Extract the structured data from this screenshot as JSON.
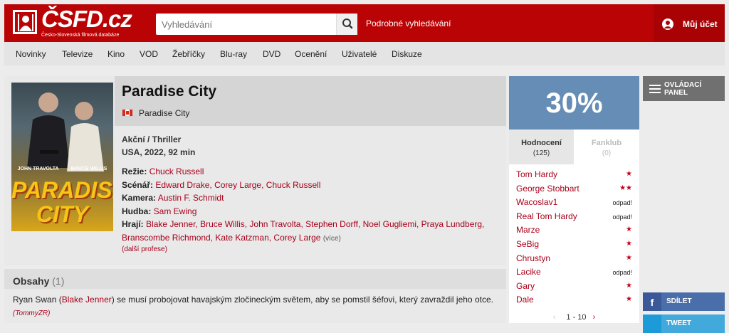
{
  "header": {
    "logo_text": "ČSFD.cz",
    "logo_subtitle": "Česko-Slovenská filmová databáze",
    "search_placeholder": "Vyhledávání",
    "advanced_search": "Podrobné vyhledávání",
    "account_label": "Můj účet",
    "brand_color": "#ba0305"
  },
  "nav": {
    "items": [
      "Novinky",
      "Televize",
      "Kino",
      "VOD",
      "Žebříčky",
      "Blu-ray",
      "DVD",
      "Ocenění",
      "Uživatelé",
      "Diskuze"
    ]
  },
  "film": {
    "title": "Paradise City",
    "original_title": "Paradise City",
    "poster_actor_1": "JOHN TRAVOLTA",
    "poster_actor_2": "BRUCE WILLIS",
    "poster_title": "PARADISE CITY",
    "genre": "Akční / Thriller",
    "origin": "USA, 2022, 92 min",
    "director_label": "Režie:",
    "director": "Chuck Russell",
    "writer_label": "Scénář:",
    "writers": "Edward Drake, Corey Large, Chuck Russell",
    "camera_label": "Kamera:",
    "camera": "Austin F. Schmidt",
    "music_label": "Hudba:",
    "music": "Sam Ewing",
    "cast_label": "Hrají:",
    "cast": "Blake Jenner, Bruce Willis, John Travolta, Stephen Dorff, Noel Gugliemi, Praya Lundberg, Branscombe Richmond, Kate Katzman, Corey Large",
    "cast_more": "(více)",
    "more_professions": "(další profese)"
  },
  "plot": {
    "title": "Obsahy",
    "count": "(1)",
    "text_before": "Ryan Swan (",
    "actor": "Blake Jenner",
    "text_after": ") se musí probojovat havajským zločineckým světem, aby se pomstil šéfovi, který zavraždil jeho otce.",
    "author": "(TommyZR)"
  },
  "rating": {
    "value": "30%",
    "tab_ratings": "Hodnocení",
    "tab_ratings_count": "(125)",
    "tab_fanclub": "Fanklub",
    "tab_fanclub_count": "(0)",
    "users": [
      {
        "name": "Tom Hardy",
        "rating": "★"
      },
      {
        "name": "George Stobbart",
        "rating": "★★"
      },
      {
        "name": "Wacoslav1",
        "rating": "odpad!"
      },
      {
        "name": "Real Tom Hardy",
        "rating": "odpad!"
      },
      {
        "name": "Marze",
        "rating": "★"
      },
      {
        "name": "SeBig",
        "rating": "★"
      },
      {
        "name": "Chrustyn",
        "rating": "★"
      },
      {
        "name": "Lacike",
        "rating": "odpad!"
      },
      {
        "name": "Gary",
        "rating": "★"
      },
      {
        "name": "Dale",
        "rating": "★"
      }
    ],
    "pager_prev": "‹",
    "pager_text": "1 - 10",
    "pager_next": "›",
    "box_color": "#658db5"
  },
  "sidebar": {
    "control_panel": "OVLÁDACÍ PANEL",
    "share_facebook": "SDÍLET",
    "share_twitter": "TWEET"
  }
}
